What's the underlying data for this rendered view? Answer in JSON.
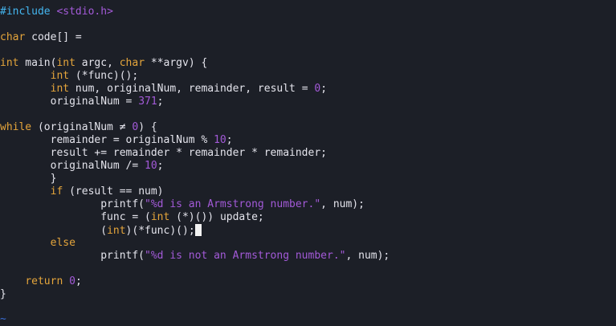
{
  "colors": {
    "background": "#1c1f27",
    "default": "#e4e4ec",
    "preproc": "#44b6f0",
    "keyword": "#e5a53b",
    "string": "#a35ad8",
    "number": "#a35ad8",
    "comment": "#3a6fd8",
    "cursor": "#f2f2f2"
  },
  "editor": {
    "lines": [
      [
        {
          "t": "#include ",
          "c": "preproc"
        },
        {
          "t": "<stdio.h>",
          "c": "string"
        }
      ],
      [],
      [
        {
          "t": "char",
          "c": "keyword"
        },
        {
          "t": " code[] =",
          "c": "default"
        }
      ],
      [],
      [
        {
          "t": "int",
          "c": "keyword"
        },
        {
          "t": " main(",
          "c": "default"
        },
        {
          "t": "int",
          "c": "keyword"
        },
        {
          "t": " argc, ",
          "c": "default"
        },
        {
          "t": "char",
          "c": "keyword"
        },
        {
          "t": " **argv) {",
          "c": "default"
        }
      ],
      [
        {
          "t": "        ",
          "c": "default"
        },
        {
          "t": "int",
          "c": "keyword"
        },
        {
          "t": " (*func)();",
          "c": "default"
        }
      ],
      [
        {
          "t": "        ",
          "c": "default"
        },
        {
          "t": "int",
          "c": "keyword"
        },
        {
          "t": " num, originalNum, remainder, result = ",
          "c": "default"
        },
        {
          "t": "0",
          "c": "number"
        },
        {
          "t": ";",
          "c": "default"
        }
      ],
      [
        {
          "t": "        originalNum = ",
          "c": "default"
        },
        {
          "t": "371",
          "c": "number"
        },
        {
          "t": ";",
          "c": "default"
        }
      ],
      [],
      [
        {
          "t": "while",
          "c": "keyword"
        },
        {
          "t": " (originalNum ≠ ",
          "c": "default"
        },
        {
          "t": "0",
          "c": "number"
        },
        {
          "t": ") {",
          "c": "default"
        }
      ],
      [
        {
          "t": "        remainder = originalNum % ",
          "c": "default"
        },
        {
          "t": "10",
          "c": "number"
        },
        {
          "t": ";",
          "c": "default"
        }
      ],
      [
        {
          "t": "        result += remainder * remainder * remainder;",
          "c": "default"
        }
      ],
      [
        {
          "t": "        originalNum /= ",
          "c": "default"
        },
        {
          "t": "10",
          "c": "number"
        },
        {
          "t": ";",
          "c": "default"
        }
      ],
      [
        {
          "t": "        }",
          "c": "default"
        }
      ],
      [
        {
          "t": "        ",
          "c": "default"
        },
        {
          "t": "if",
          "c": "keyword"
        },
        {
          "t": " (result == num)",
          "c": "default"
        }
      ],
      [
        {
          "t": "                printf(",
          "c": "default"
        },
        {
          "t": "\"%d is an Armstrong number.\"",
          "c": "string"
        },
        {
          "t": ", num);",
          "c": "default"
        }
      ],
      [
        {
          "t": "                func = (",
          "c": "default"
        },
        {
          "t": "int",
          "c": "keyword"
        },
        {
          "t": " (*)()) update;",
          "c": "default"
        }
      ],
      [
        {
          "t": "                (",
          "c": "default"
        },
        {
          "t": "int",
          "c": "keyword"
        },
        {
          "t": ")(*func)();",
          "c": "default"
        },
        {
          "cursor": true
        }
      ],
      [
        {
          "t": "        ",
          "c": "default"
        },
        {
          "t": "else",
          "c": "keyword"
        }
      ],
      [
        {
          "t": "                printf(",
          "c": "default"
        },
        {
          "t": "\"%d is not an Armstrong number.\"",
          "c": "string"
        },
        {
          "t": ", num);",
          "c": "default"
        }
      ],
      [],
      [
        {
          "t": "    ",
          "c": "default"
        },
        {
          "t": "return",
          "c": "keyword"
        },
        {
          "t": " ",
          "c": "default"
        },
        {
          "t": "0",
          "c": "number"
        },
        {
          "t": ";",
          "c": "default"
        }
      ],
      [
        {
          "t": "}",
          "c": "default"
        }
      ]
    ],
    "empty_line_marker": "~"
  }
}
